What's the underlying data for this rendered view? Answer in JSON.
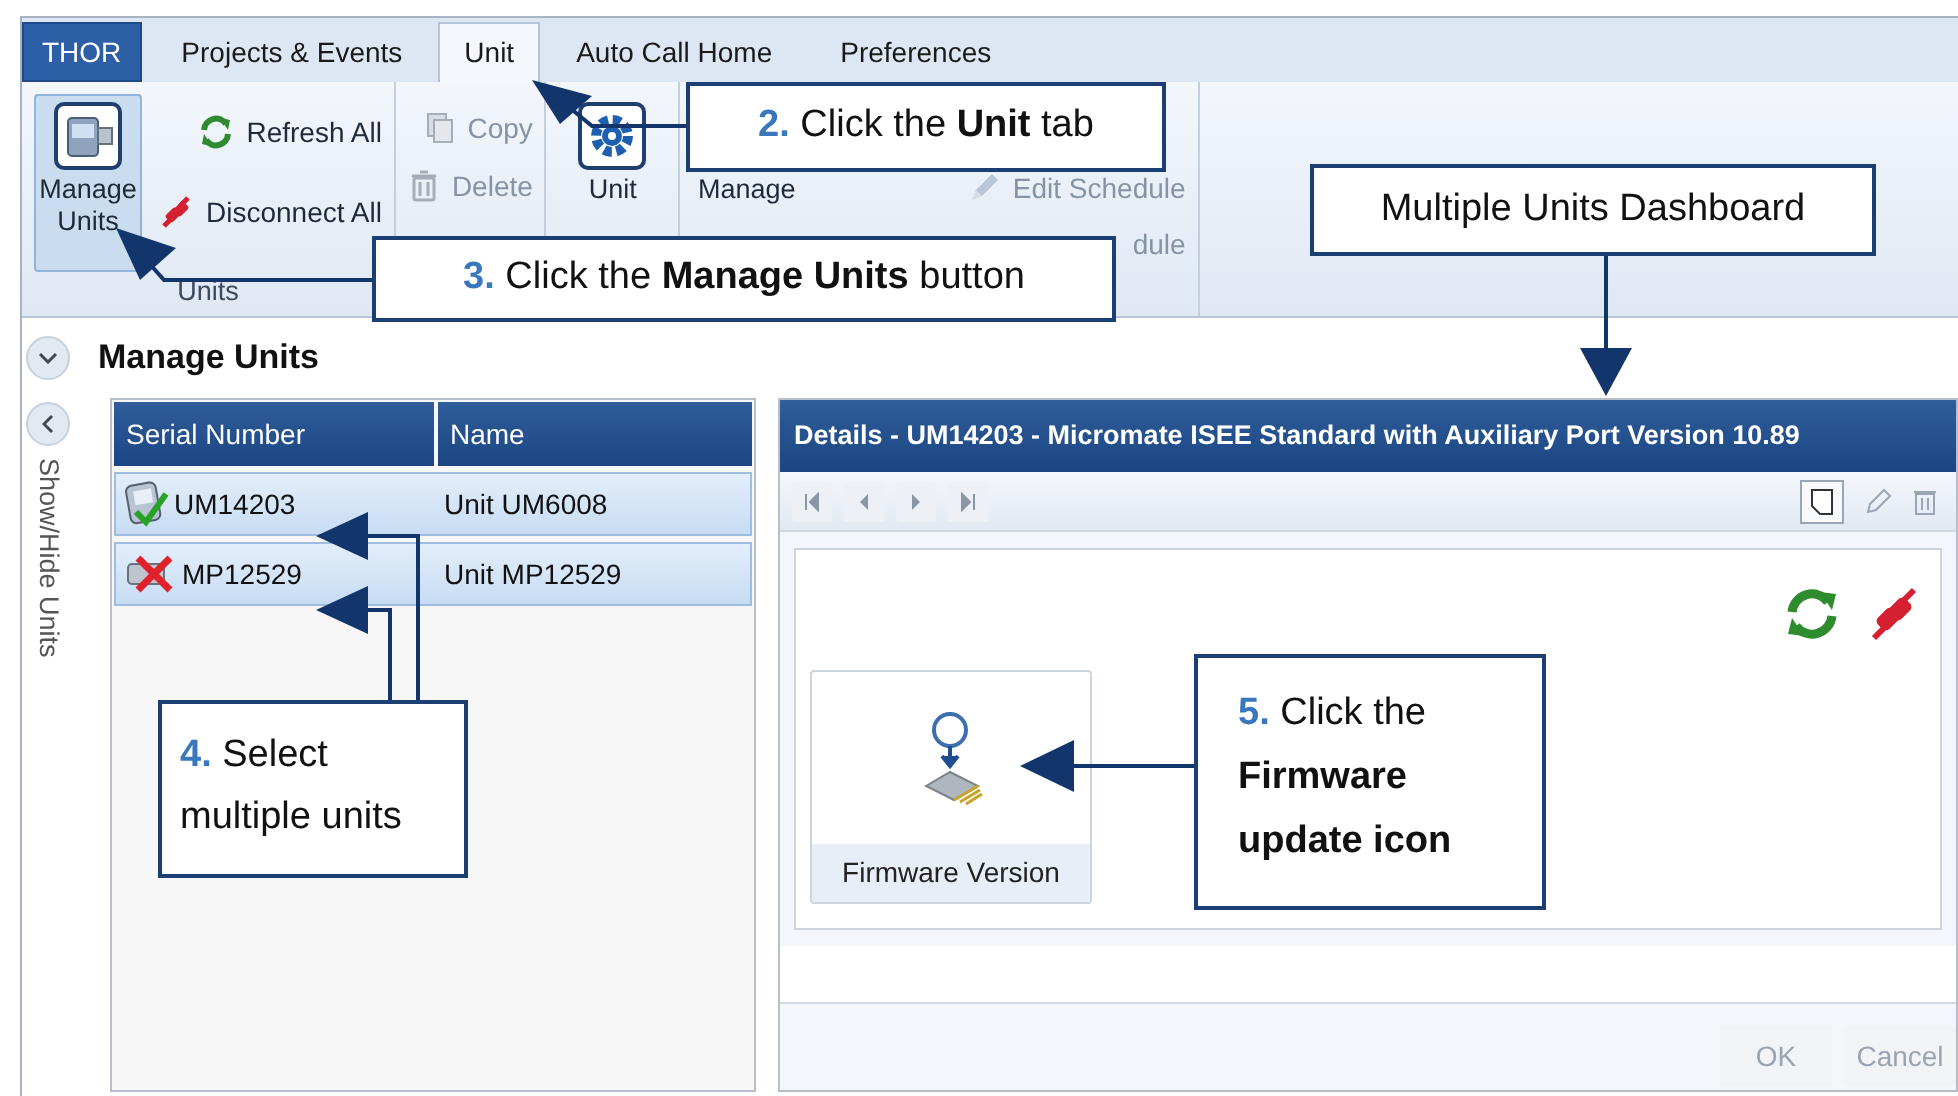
{
  "tabs": [
    {
      "label": "THOR",
      "kind": "app",
      "selected": false
    },
    {
      "label": "Projects & Events",
      "kind": "tab",
      "selected": false
    },
    {
      "label": "Unit",
      "kind": "tab",
      "selected": true
    },
    {
      "label": "Auto Call Home",
      "kind": "tab",
      "selected": false
    },
    {
      "label": "Preferences",
      "kind": "tab",
      "selected": false
    }
  ],
  "ribbon": {
    "groups": [
      {
        "label": "Units",
        "items": [
          {
            "label": "Manage Units",
            "kind": "large",
            "selected": true,
            "disabled": false
          },
          {
            "label": "Refresh All",
            "kind": "small",
            "selected": false,
            "disabled": false
          },
          {
            "label": "Disconnect All",
            "kind": "small",
            "selected": false,
            "disabled": false
          }
        ]
      },
      {
        "items": [
          {
            "label": "Copy",
            "kind": "small",
            "selected": false,
            "disabled": true
          },
          {
            "label": "Delete",
            "kind": "small",
            "selected": false,
            "disabled": true
          }
        ]
      },
      {
        "items": [
          {
            "label": "Unit",
            "kind": "large",
            "selected": false,
            "disabled": false
          }
        ]
      },
      {
        "items": [
          {
            "label": "Manage",
            "kind": "large",
            "selected": false,
            "disabled": false
          },
          {
            "label": "Edit Schedule",
            "kind": "small",
            "selected": false,
            "disabled": true
          },
          {
            "label": "dule",
            "kind": "small",
            "selected": false,
            "disabled": true
          }
        ]
      }
    ]
  },
  "section": {
    "title": "Manage Units"
  },
  "sidebar": {
    "label": "Show/Hide Units"
  },
  "units_grid": {
    "columns": [
      "Serial Number",
      "Name"
    ],
    "rows": [
      {
        "serial": "UM14203",
        "name": "Unit UM6008",
        "kind": "connected",
        "selected": true
      },
      {
        "serial": "MP12529",
        "name": "Unit MP12529",
        "kind": "disconnected",
        "selected": true
      }
    ]
  },
  "details": {
    "title": "Details - UM14203 - Micromate ISEE Standard with Auxiliary Port Version 10.89",
    "tiles": [
      {
        "label": "Firmware Version"
      }
    ],
    "buttons": [
      {
        "label": "OK",
        "disabled": true
      },
      {
        "label": "Cancel",
        "disabled": true
      }
    ]
  },
  "callouts": [
    {
      "step": "2.",
      "text": "Click the **Unit** tab"
    },
    {
      "step": "3.",
      "text": "Click the **Manage Units** button"
    },
    {
      "text": "Multiple Units Dashboard"
    },
    {
      "step": "4.",
      "text": "Select multiple units"
    },
    {
      "step": "5.",
      "text": "Click the **Firmware update icon**"
    }
  ]
}
